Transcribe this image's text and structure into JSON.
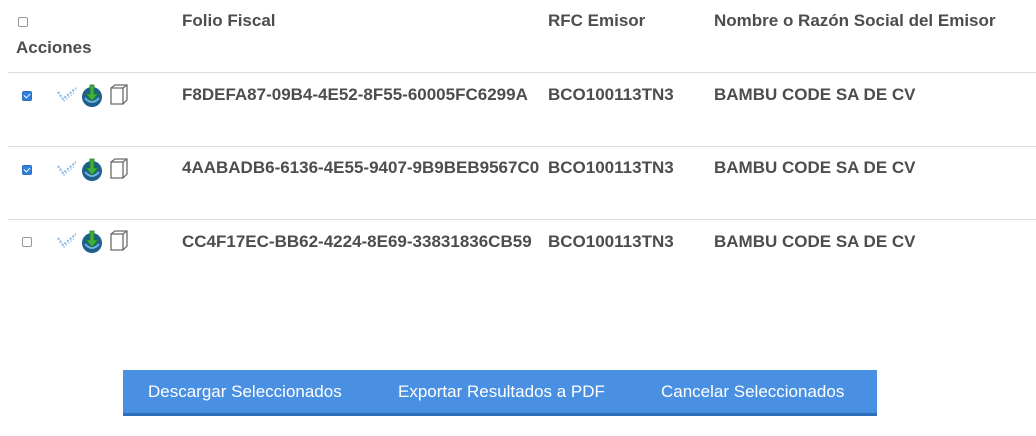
{
  "header": {
    "acciones": "Acciones",
    "folio": "Folio Fiscal",
    "rfc": "RFC Emisor",
    "nombre": "Nombre o Razón Social del Emisor"
  },
  "rows": [
    {
      "checked": true,
      "folio": "F8DEFA87-09B4-4E52-8F55-60005FC6299A",
      "rfc": "BCO100113TN3",
      "nombre": "BAMBU CODE SA DE CV"
    },
    {
      "checked": true,
      "folio": "4AABADB6-6136-4E55-9407-9B9BEB9567C0",
      "rfc": "BCO100113TN3",
      "nombre": "BAMBU CODE SA DE CV"
    },
    {
      "checked": false,
      "folio": "CC4F17EC-BB62-4224-8E69-33831836CB59",
      "rfc": "BCO100113TN3",
      "nombre": "BAMBU CODE SA DE CV"
    }
  ],
  "buttons": {
    "download": "Descargar Seleccionados",
    "export": "Exportar Resultados a PDF",
    "cancel": "Cancelar Seleccionados"
  },
  "colors": {
    "button_bar": "#4a90e2",
    "checkbox_checked": "#2f7fdb"
  },
  "icons": [
    "verify-icon",
    "download-icon",
    "document-icon"
  ]
}
